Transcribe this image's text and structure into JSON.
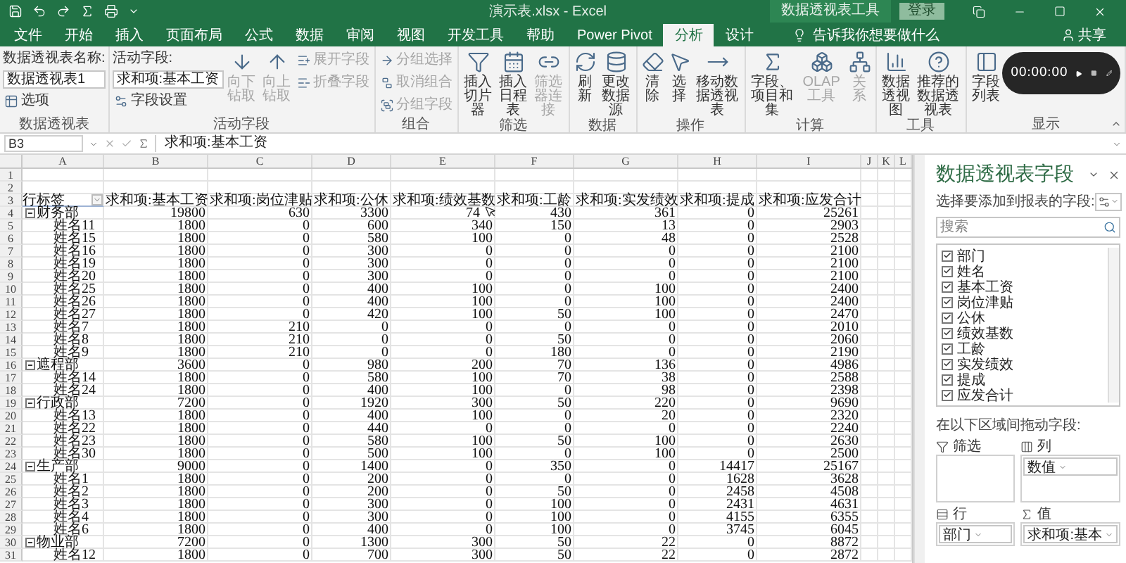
{
  "window": {
    "title": "演示表.xlsx  -  Excel",
    "context_title": "数据透视表工具",
    "sign_in": "登录"
  },
  "tabs": [
    {
      "label": "文件",
      "selected": false
    },
    {
      "label": "开始",
      "selected": false
    },
    {
      "label": "插入",
      "selected": false
    },
    {
      "label": "页面布局",
      "selected": false
    },
    {
      "label": "公式",
      "selected": false
    },
    {
      "label": "数据",
      "selected": false
    },
    {
      "label": "审阅",
      "selected": false
    },
    {
      "label": "视图",
      "selected": false
    },
    {
      "label": "开发工具",
      "selected": false
    },
    {
      "label": "帮助",
      "selected": false
    },
    {
      "label": "Power Pivot",
      "selected": false
    },
    {
      "label": "分析",
      "selected": true
    },
    {
      "label": "设计",
      "selected": false
    }
  ],
  "tell_me": "告诉我你想要做什么",
  "share": "共享",
  "ribbon": [
    {
      "label": "数据透视表",
      "items": [
        {
          "kind": "caption",
          "label": "数据透视表名称:"
        },
        {
          "kind": "field",
          "label": "数据透视表1"
        },
        {
          "kind": "small",
          "label": "选项",
          "disabled": false
        }
      ]
    },
    {
      "label": "活动字段",
      "items": [
        {
          "kind": "caption",
          "label": "活动字段:"
        },
        {
          "kind": "field",
          "label": "求和项:基本工资"
        },
        {
          "kind": "small",
          "label": "字段设置",
          "disabled": false
        },
        {
          "kind": "large",
          "label": "向下钻取",
          "disabled": true
        },
        {
          "kind": "large",
          "label": "向上钻取",
          "disabled": true
        },
        {
          "kind": "small",
          "label": "展开字段",
          "disabled": true
        },
        {
          "kind": "small",
          "label": "折叠字段",
          "disabled": true
        }
      ]
    },
    {
      "label": "组合",
      "items": [
        {
          "kind": "small",
          "label": "分组选择",
          "disabled": true
        },
        {
          "kind": "small",
          "label": "取消组合",
          "disabled": true
        },
        {
          "kind": "small",
          "label": "分组字段",
          "disabled": true
        }
      ]
    },
    {
      "label": "筛选",
      "items": [
        {
          "kind": "large",
          "label": "插入切片器",
          "disabled": false
        },
        {
          "kind": "large",
          "label": "插入日程表",
          "disabled": false
        },
        {
          "kind": "large",
          "label": "筛选器连接",
          "disabled": true
        }
      ]
    },
    {
      "label": "数据",
      "items": [
        {
          "kind": "large",
          "label": "刷新",
          "disabled": false
        },
        {
          "kind": "large",
          "label": "更改数据源",
          "disabled": false
        }
      ]
    },
    {
      "label": "操作",
      "items": [
        {
          "kind": "large",
          "label": "清除",
          "disabled": false
        },
        {
          "kind": "large",
          "label": "选择",
          "disabled": false
        },
        {
          "kind": "large",
          "label": "移动数据透视表",
          "disabled": false
        }
      ]
    },
    {
      "label": "计算",
      "items": [
        {
          "kind": "large",
          "label": "字段、项目和集",
          "disabled": false
        },
        {
          "kind": "large",
          "label": "OLAP 工具",
          "disabled": true
        },
        {
          "kind": "large",
          "label": "关系",
          "disabled": true
        }
      ]
    },
    {
      "label": "工具",
      "items": [
        {
          "kind": "large",
          "label": "数据透视图",
          "disabled": false
        },
        {
          "kind": "large",
          "label": "推荐的数据透视表",
          "disabled": false
        }
      ]
    },
    {
      "label": "显示",
      "items": [
        {
          "kind": "large",
          "label": "字段列表",
          "disabled": false
        }
      ]
    }
  ],
  "recorder": {
    "time": "00:00:00"
  },
  "formula_bar": {
    "name_box": "B3",
    "content": "求和项:基本工资"
  },
  "sheet": {
    "columns": [
      "A",
      "B",
      "C",
      "D",
      "E",
      "F",
      "G",
      "H",
      "I",
      "J",
      "K",
      "L"
    ],
    "row_numbers": [
      "1",
      "2",
      "3",
      "4",
      "5",
      "6",
      "7",
      "8",
      "9",
      "10",
      "11",
      "12",
      "13",
      "14",
      "15",
      "16",
      "17",
      "18",
      "19",
      "20",
      "21",
      "22",
      "23",
      "24",
      "25",
      "26",
      "27",
      "28",
      "29",
      "30",
      "31"
    ],
    "header": [
      "行标签",
      "求和项:基本工资",
      "求和项:岗位津贴",
      "求和项:公休",
      "求和项:绩效基数",
      "求和项:工龄",
      "求和项:实发绩效",
      "求和项:提成",
      "求和项:应发合计"
    ],
    "groups": [
      {
        "label": "财务部",
        "expanded": true,
        "values": [
          "19800",
          "630",
          "3300",
          "74",
          "430",
          "361",
          "0",
          "25261"
        ],
        "children": [
          {
            "label": "姓名11",
            "values": [
              "1800",
              "0",
              "600",
              "340",
              "150",
              "13",
              "0",
              "2903"
            ]
          },
          {
            "label": "姓名15",
            "values": [
              "1800",
              "0",
              "580",
              "100",
              "0",
              "48",
              "0",
              "2528"
            ]
          },
          {
            "label": "姓名16",
            "values": [
              "1800",
              "0",
              "300",
              "0",
              "0",
              "0",
              "0",
              "2100"
            ]
          },
          {
            "label": "姓名19",
            "values": [
              "1800",
              "0",
              "300",
              "0",
              "0",
              "0",
              "0",
              "2100"
            ]
          },
          {
            "label": "姓名20",
            "values": [
              "1800",
              "0",
              "300",
              "0",
              "0",
              "0",
              "0",
              "2100"
            ]
          },
          {
            "label": "姓名25",
            "values": [
              "1800",
              "0",
              "400",
              "100",
              "0",
              "100",
              "0",
              "2400"
            ]
          },
          {
            "label": "姓名26",
            "values": [
              "1800",
              "0",
              "400",
              "100",
              "0",
              "100",
              "0",
              "2400"
            ]
          },
          {
            "label": "姓名27",
            "values": [
              "1800",
              "0",
              "420",
              "100",
              "50",
              "100",
              "0",
              "2470"
            ]
          },
          {
            "label": "姓名7",
            "values": [
              "1800",
              "210",
              "0",
              "0",
              "0",
              "0",
              "0",
              "2010"
            ]
          },
          {
            "label": "姓名8",
            "values": [
              "1800",
              "210",
              "0",
              "0",
              "50",
              "0",
              "0",
              "2060"
            ]
          },
          {
            "label": "姓名9",
            "values": [
              "1800",
              "210",
              "0",
              "0",
              "180",
              "0",
              "0",
              "2190"
            ]
          }
        ]
      },
      {
        "label": "遮程部",
        "expanded": true,
        "values": [
          "3600",
          "0",
          "980",
          "200",
          "70",
          "136",
          "0",
          "4986"
        ],
        "children": [
          {
            "label": "姓名14",
            "values": [
              "1800",
              "0",
              "580",
              "100",
              "70",
              "38",
              "0",
              "2588"
            ]
          },
          {
            "label": "姓名24",
            "values": [
              "1800",
              "0",
              "400",
              "100",
              "0",
              "98",
              "0",
              "2398"
            ]
          }
        ]
      },
      {
        "label": "行政部",
        "expanded": true,
        "values": [
          "7200",
          "0",
          "1920",
          "300",
          "50",
          "220",
          "0",
          "9690"
        ],
        "children": [
          {
            "label": "姓名13",
            "values": [
              "1800",
              "0",
              "400",
              "100",
              "0",
              "20",
              "0",
              "2320"
            ]
          },
          {
            "label": "姓名22",
            "values": [
              "1800",
              "0",
              "440",
              "0",
              "0",
              "0",
              "0",
              "2240"
            ]
          },
          {
            "label": "姓名23",
            "values": [
              "1800",
              "0",
              "580",
              "100",
              "50",
              "100",
              "0",
              "2630"
            ]
          },
          {
            "label": "姓名30",
            "values": [
              "1800",
              "0",
              "500",
              "100",
              "0",
              "100",
              "0",
              "2500"
            ]
          }
        ]
      },
      {
        "label": "生产部",
        "expanded": true,
        "values": [
          "9000",
          "0",
          "1400",
          "0",
          "350",
          "0",
          "14417",
          "25167"
        ],
        "children": [
          {
            "label": "姓名1",
            "values": [
              "1800",
              "0",
              "200",
              "0",
              "0",
              "0",
              "1628",
              "3628"
            ]
          },
          {
            "label": "姓名2",
            "values": [
              "1800",
              "0",
              "200",
              "0",
              "50",
              "0",
              "2458",
              "4508"
            ]
          },
          {
            "label": "姓名3",
            "values": [
              "1800",
              "0",
              "300",
              "0",
              "100",
              "0",
              "2431",
              "4631"
            ]
          },
          {
            "label": "姓名4",
            "values": [
              "1800",
              "0",
              "300",
              "0",
              "100",
              "0",
              "4155",
              "6355"
            ]
          },
          {
            "label": "姓名6",
            "values": [
              "1800",
              "0",
              "400",
              "0",
              "100",
              "0",
              "3745",
              "6045"
            ]
          }
        ]
      },
      {
        "label": "物业部",
        "expanded": true,
        "values": [
          "7200",
          "0",
          "1300",
          "300",
          "50",
          "22",
          "0",
          "8872"
        ],
        "children": [
          {
            "label": "姓名12",
            "values": [
              "1800",
              "0",
              "700",
              "300",
              "50",
              "22",
              "0",
              "2872"
            ]
          }
        ]
      }
    ]
  },
  "field_pane": {
    "title": "数据透视表字段",
    "subtitle": "选择要添加到报表的字段:",
    "search": {
      "placeholder": "搜索"
    },
    "fields": [
      {
        "label": "部门",
        "checked": true
      },
      {
        "label": "姓名",
        "checked": true
      },
      {
        "label": "基本工资",
        "checked": true
      },
      {
        "label": "岗位津贴",
        "checked": true
      },
      {
        "label": "公休",
        "checked": true
      },
      {
        "label": "绩效基数",
        "checked": true
      },
      {
        "label": "工龄",
        "checked": true
      },
      {
        "label": "实发绩效",
        "checked": true
      },
      {
        "label": "提成",
        "checked": true
      },
      {
        "label": "应发合计",
        "checked": true
      }
    ],
    "drag_hint": "在以下区域间拖动字段:",
    "areas": [
      {
        "kind": "filter",
        "label": "筛选"
      },
      {
        "kind": "columns",
        "label": "列",
        "items": [
          "数值"
        ]
      },
      {
        "kind": "rows",
        "label": "行",
        "items": [
          "部门"
        ]
      },
      {
        "kind": "values",
        "label": "值",
        "items": [
          "求和项:基本"
        ]
      }
    ]
  }
}
